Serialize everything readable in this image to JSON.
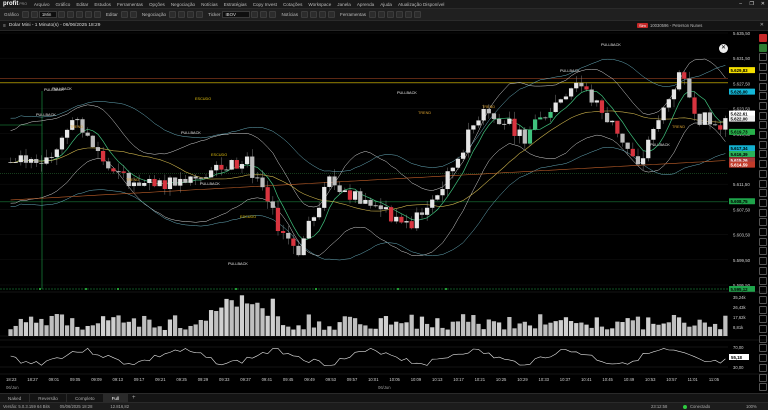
{
  "app": {
    "logo": "profit",
    "logo_tag": "PRO",
    "menu": [
      "Arquivo",
      "Gráfico",
      "Editar",
      "Estudos",
      "Ferramentas",
      "Opções",
      "Negociação",
      "Notícias",
      "Estratégias",
      "Copy Invest",
      "Cotações",
      "Workspace",
      "Janela",
      "Aprenda",
      "Ajuda",
      "Atualização Disponível"
    ],
    "window_controls": [
      "–",
      "❐",
      "✕"
    ]
  },
  "toolbar": {
    "chart_label": "Gráfico",
    "timeframe": "1Min",
    "edit_label": "Editar",
    "trade_label": "Negociação",
    "ticker_label": "Ticker",
    "ticker": "IBOV",
    "news_label": "Notícias",
    "tools_label": "Ferramentas"
  },
  "chart_window": {
    "title": "Dolar Mini - 1 Minuto(s) - 06/06/2025 18:29",
    "sim_badge": "Sim",
    "account": "10030596 - Peterson Nunes"
  },
  "price_axis": {
    "ticks": [
      "5.635,50",
      "5.631,50",
      "5.627,50",
      "5.623,50",
      "5.619,50",
      "5.615,50",
      "5.611,50",
      "5.607,50",
      "5.603,50",
      "5.599,50",
      "5.595,50"
    ],
    "tags": [
      {
        "text": "5.629,83",
        "color": "#f5e000",
        "fg": "#000"
      },
      {
        "text": "5.626,00",
        "color": "#14b8d8",
        "fg": "#000"
      },
      {
        "text": "5.622,61",
        "color": "#ffffff",
        "fg": "#000"
      },
      {
        "text": "5.622,00",
        "color": "#eeeeee",
        "fg": "#000"
      },
      {
        "text": "5.619,73",
        "color": "#27b14a",
        "fg": "#000"
      },
      {
        "text": "5.617,34",
        "color": "#13b0cf",
        "fg": "#000"
      },
      {
        "text": "5.616,39",
        "color": "#2ab35a",
        "fg": "#000"
      },
      {
        "text": "5.615,26",
        "color": "#a83a3a",
        "fg": "#fff"
      },
      {
        "text": "5.614,59",
        "color": "#c23b2a",
        "fg": "#fff"
      },
      {
        "text": "5.608,75",
        "color": "#1ea34a",
        "fg": "#000"
      },
      {
        "text": "5.595,12",
        "color": "#1ea34a",
        "fg": "#000"
      }
    ]
  },
  "volume_axis": {
    "ticks": [
      "35,24k",
      "26,43k",
      "17,62k",
      "8,81k"
    ]
  },
  "oscillator_axis": {
    "ticks": [
      "70,00",
      "30,00"
    ],
    "current": "55,18"
  },
  "date_labels": {
    "left": "06/Jun",
    "center": "06/Jun"
  },
  "time_axis": [
    "18:23",
    "18:27",
    "09:01",
    "09:05",
    "09:09",
    "09:13",
    "09:17",
    "09:21",
    "09:25",
    "09:29",
    "09:33",
    "09:37",
    "09:41",
    "09:45",
    "09:49",
    "09:53",
    "09:57",
    "10:01",
    "10:05",
    "10:09",
    "10:13",
    "10:17",
    "10:21",
    "10:25",
    "10:29",
    "10:33",
    "10:37",
    "10:41",
    "10:45",
    "10:49",
    "10:53",
    "10:57",
    "11:01",
    "11:05"
  ],
  "annotations": [
    {
      "text": "PULLBACK"
    },
    {
      "text": "PULLBACK"
    },
    {
      "text": "TREND"
    },
    {
      "text": "PULLBACK"
    },
    {
      "text": "ESCUDO"
    },
    {
      "text": "PULLBACK"
    },
    {
      "text": "ESCUDO"
    },
    {
      "text": "PULLBACK"
    },
    {
      "text": "ESCUDO"
    },
    {
      "text": "PULLBACK"
    },
    {
      "text": "PULLBACK"
    },
    {
      "text": "TREND"
    },
    {
      "text": "TREND"
    },
    {
      "text": "PULLBACK"
    },
    {
      "text": "PULLBACK"
    },
    {
      "text": "PULLBACK"
    },
    {
      "text": "TREND"
    },
    {
      "text": "TREND"
    }
  ],
  "tabs": [
    "Naked",
    "Reversão",
    "Completo",
    "Full"
  ],
  "active_tab": 3,
  "status": {
    "version": "Versão: 5.0.3.159 64 Bits",
    "datetime": "05/06/2025 18:28",
    "value": "12.816,82",
    "clock": "23:12:58",
    "connection": "Conectado",
    "zoom": "100%"
  },
  "colors": {
    "bull": "#e6e6e6",
    "bear": "#d8343f",
    "bull_alt": "#3fc27d",
    "accent_yellow": "#f5e000",
    "accent_cyan": "#14b8d8"
  }
}
